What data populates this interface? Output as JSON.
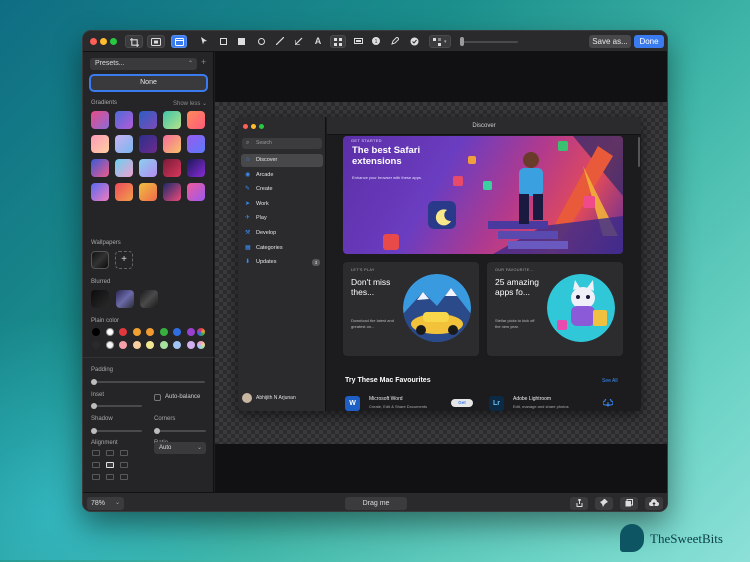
{
  "toolbar": {
    "save_label": "Save as...",
    "done_label": "Done",
    "text_tool_label": "A"
  },
  "sidebar": {
    "presets_label": "Presets...",
    "none_label": "None",
    "gradients_label": "Gradients",
    "show_less_label": "Show less",
    "wallpapers_label": "Wallpapers",
    "blurred_label": "Blurred",
    "plain_color_label": "Plain color",
    "padding_label": "Padding",
    "inset_label": "Inset",
    "auto_balance_label": "Auto-balance",
    "shadow_label": "Shadow",
    "corners_label": "Corners",
    "alignment_label": "Alignment",
    "ratio_label": "Ratio",
    "ratio_value": "Auto",
    "gradient_swatches": [
      [
        "#e94a86",
        "#8a6dd8"
      ],
      [
        "#4d6bd8",
        "#b55ad8"
      ],
      [
        "#2b5ec4",
        "#7e4ab8"
      ],
      [
        "#3fc4a8",
        "#b6e28a"
      ],
      [
        "#ff8a5c",
        "#ff5a7a"
      ],
      [
        "#ff9ab8",
        "#ffd0a0"
      ],
      [
        "#c6b2f0",
        "#7bb6f0"
      ],
      [
        "#2c2f8c",
        "#6c2b8c"
      ],
      [
        "#f46a9a",
        "#f8c26a"
      ],
      [
        "#9a5af0",
        "#5a7af8"
      ],
      [
        "#3a5ad8",
        "#f05a8a"
      ],
      [
        "#6ad0f0",
        "#f0a0d0"
      ],
      [
        "#8ad0f0",
        "#b58af0"
      ],
      [
        "#7a1a3a",
        "#d8385a"
      ],
      [
        "#1a1a5a",
        "#8a2ad8"
      ],
      [
        "#5a6af0",
        "#f07ac0"
      ],
      [
        "#f04a5a",
        "#f0a04a"
      ],
      [
        "#f0c040",
        "#f06a4a"
      ],
      [
        "#1a2a6a",
        "#f04a7a"
      ],
      [
        "#f05a9a",
        "#9a5af0"
      ]
    ],
    "plain_colors": [
      "#000000",
      "#ffffff",
      "#e0383e",
      "#f0a030",
      "#f09a30",
      "#38b040",
      "#2f6ee0",
      "#9a40d0",
      "#2a2a2a",
      "#f4f4f4",
      "#f4a0a8",
      "#f6d0a0",
      "#f0e890",
      "#a8e0a0",
      "#a0c4f4",
      "#d0b0f0"
    ]
  },
  "app": {
    "search_placeholder": "Search",
    "nav": [
      {
        "label": "Discover",
        "icon": "star-icon",
        "selected": true
      },
      {
        "label": "Arcade",
        "icon": "joystick-icon"
      },
      {
        "label": "Create",
        "icon": "brush-icon"
      },
      {
        "label": "Work",
        "icon": "paperplane-icon"
      },
      {
        "label": "Play",
        "icon": "rocket-icon"
      },
      {
        "label": "Develop",
        "icon": "hammer-icon"
      },
      {
        "label": "Categories",
        "icon": "grid-icon"
      },
      {
        "label": "Updates",
        "icon": "download-icon",
        "badge": "3"
      }
    ],
    "user_name": "Abhijith N Arjunan",
    "title": "Discover",
    "hero": {
      "kicker": "GET STARTED",
      "title": "The best Safari extensions",
      "subtitle": "Enhance your browser with these apps."
    },
    "cards": [
      {
        "kicker": "LET'S PLAY",
        "title": "Don't miss thes...",
        "subtitle": "Download the latest and greatest on..."
      },
      {
        "kicker": "OUR FAVOURITE...",
        "title": "25 amazing apps fo...",
        "subtitle": "Stellar picks to kick off the new year."
      }
    ],
    "favourites_title": "Try These Mac Favourites",
    "see_all": "See All",
    "favourites": [
      {
        "name": "Microsoft Word",
        "desc": "Create, Edit & Share Documents",
        "button": "Get",
        "icon_text": "W",
        "color": "#1d5fc4"
      },
      {
        "name": "Adobe Lightroom",
        "desc": "Edit, manage and share photos",
        "icon_text": "Lr",
        "color": "#0d2a44"
      }
    ]
  },
  "bottombar": {
    "zoom": "78%",
    "drag_label": "Drag me"
  },
  "brand": "TheSweetBits"
}
